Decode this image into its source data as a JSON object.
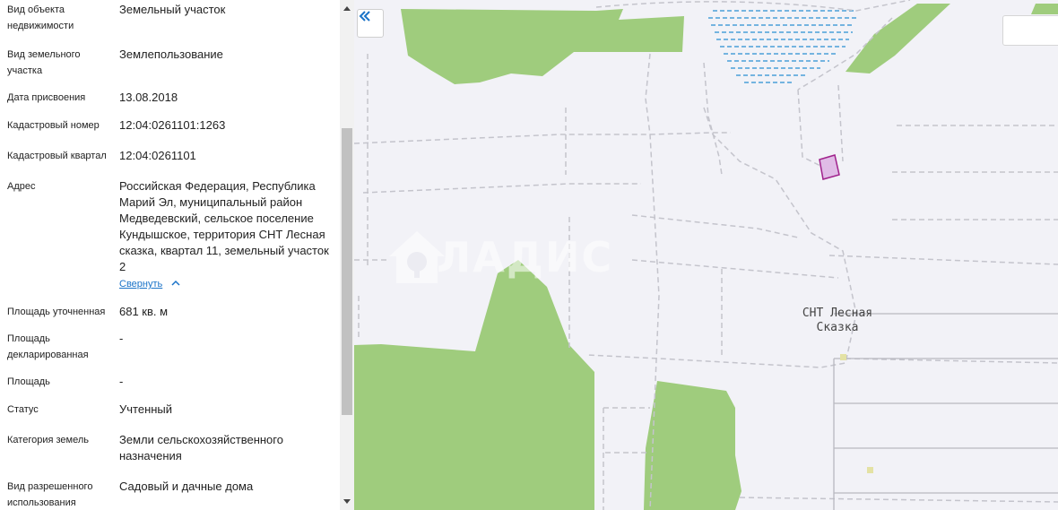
{
  "fields": [
    {
      "label": "Вид объекта недвижимости",
      "value": "Земельный участок"
    },
    {
      "label": "Вид земельного участка",
      "value": "Землепользование"
    },
    {
      "label": "Дата присвоения",
      "value": "13.08.2018"
    },
    {
      "label": "Кадастровый номер",
      "value": "12:04:0261101:1263"
    },
    {
      "label": "Кадастровый квартал",
      "value": "12:04:0261101"
    },
    {
      "label": "Адрес",
      "value": "Российская Федерация, Республика Марий Эл, муниципальный район Медведевский, сельское поселение Кундышское, территория СНТ Лесная сказка, квартал 11, земельный участок 2"
    },
    {
      "label": "Площадь уточненная",
      "value": "681 кв. м"
    },
    {
      "label": "Площадь декларированная",
      "value": "-"
    },
    {
      "label": "Площадь",
      "value": "-"
    },
    {
      "label": "Статус",
      "value": "Учтенный"
    },
    {
      "label": "Категория земель",
      "value": "Земли сельскохозяйственного назначения"
    },
    {
      "label": "Вид разрешенного использования",
      "value": "Садовый и дачные дома"
    }
  ],
  "collapse_link": "Свернуть",
  "map": {
    "area_label_line1": "СНТ Лесная",
    "area_label_line2": "Сказка",
    "watermark": "ВЛАДИС",
    "forest_color": "#9fcc7d",
    "water_color": "#4a9fd8",
    "parcel_color": "#a0228c"
  },
  "icons": {
    "collapse_panel": "double-chevron-left-icon",
    "collapse_link": "chevron-up-icon",
    "watermark_logo": "house-logo-icon"
  }
}
